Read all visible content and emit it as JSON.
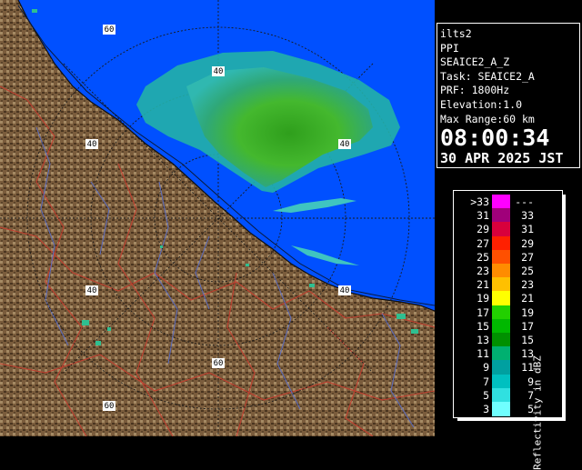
{
  "radar": {
    "range_labels": [
      "60",
      "40",
      "40",
      "40",
      "40",
      "40",
      "60"
    ]
  },
  "info": {
    "station": "ilts2",
    "scan_type": "PPI",
    "product": "SEAICE2_A_Z",
    "task": "Task: SEAICE2_A",
    "prf": "PRF: 1800Hz",
    "elevation": "Elevation:1.0",
    "max_range": "Max Range:60 km",
    "time": "08:00:34",
    "date": "30 APR 2025 JST"
  },
  "legend": {
    "title": "Reflectivity in dBZ",
    "rows": [
      {
        "lo": ">33",
        "hi": "---",
        "color": "#ff00ff"
      },
      {
        "lo": "31",
        "hi": "33",
        "color": "#a0007a"
      },
      {
        "lo": "29",
        "hi": "31",
        "color": "#d8003c"
      },
      {
        "lo": "27",
        "hi": "29",
        "color": "#ff2000"
      },
      {
        "lo": "25",
        "hi": "27",
        "color": "#ff5000"
      },
      {
        "lo": "23",
        "hi": "25",
        "color": "#ff8c00"
      },
      {
        "lo": "21",
        "hi": "23",
        "color": "#ffc000"
      },
      {
        "lo": "19",
        "hi": "21",
        "color": "#ffff00"
      },
      {
        "lo": "17",
        "hi": "19",
        "color": "#22d000"
      },
      {
        "lo": "15",
        "hi": "17",
        "color": "#00b800"
      },
      {
        "lo": "13",
        "hi": "15",
        "color": "#009000"
      },
      {
        "lo": "11",
        "hi": "13",
        "color": "#00b070"
      },
      {
        "lo": "9",
        "hi": "11",
        "color": "#00a0a0"
      },
      {
        "lo": "7",
        "hi": "9",
        "color": "#00c0c0"
      },
      {
        "lo": "5",
        "hi": "7",
        "color": "#30e0e0"
      },
      {
        "lo": "3",
        "hi": "5",
        "color": "#70ffff"
      }
    ]
  },
  "colors": {
    "sea": "#0050ff",
    "land": "#7a5c3c",
    "land_light": "#a58a64",
    "land_dark": "#4a3520",
    "border": "#c04030",
    "river": "#5a6cc0",
    "echo_light": "#2aa8a0",
    "echo_green": "#40b828",
    "range_ring": "#1a1a1a"
  }
}
